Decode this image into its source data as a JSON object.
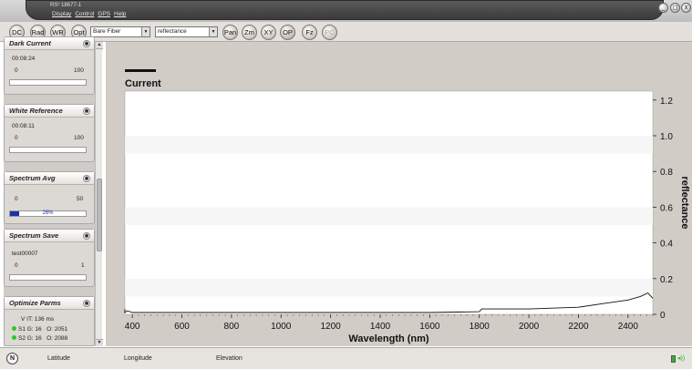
{
  "window": {
    "title": "RS³ 18677-1",
    "menu": [
      "Display",
      "Control",
      "GPS",
      "Help"
    ],
    "controls": [
      "_",
      "◻",
      "x"
    ]
  },
  "toolbar": {
    "buttons": [
      {
        "label": "DC",
        "state": "normal"
      },
      {
        "label": "Rad",
        "state": "normal"
      },
      {
        "label": "WR",
        "state": "normal"
      },
      {
        "label": "Opt",
        "state": "normal"
      },
      {
        "label": "Pan",
        "state": "normal"
      },
      {
        "label": "Zm",
        "state": "normal"
      },
      {
        "label": "XY",
        "state": "normal"
      },
      {
        "label": "OP",
        "state": "active"
      },
      {
        "label": "Fz",
        "state": "normal"
      },
      {
        "label": "PC",
        "state": "disabled"
      }
    ],
    "foreoptic_select": "Bare Fiber",
    "mode_select": "reflectance"
  },
  "sidebar": {
    "dark_current": {
      "title": "Dark Current",
      "time": "00:08:24",
      "min": "0",
      "max": "100",
      "progress": 0
    },
    "white_reference": {
      "title": "White Reference",
      "time": "00:08:11",
      "min": "0",
      "max": "100",
      "progress": 0
    },
    "spectrum_avg": {
      "title": "Spectrum Avg",
      "min": "0",
      "max": "50",
      "progress_text": "26%",
      "progress": 0.26
    },
    "spectrum_save": {
      "title": "Spectrum Save",
      "filename": "test00007",
      "min": "0",
      "max": "1",
      "progress": 0
    },
    "optimize_parms": {
      "title": "Optimize Parms",
      "vit": "V IT: 136 ms",
      "s1": "S1 G: 16   O: 2051",
      "s2": "S2 G: 16   O: 2088"
    }
  },
  "status": {
    "latitude_label": "Latitude",
    "longitude_label": "Longitude",
    "elevation_label": "Elevation"
  },
  "chart_data": {
    "type": "line",
    "legend": [
      "Current"
    ],
    "xlabel": "Wavelength (nm)",
    "ylabel": "reflectance",
    "xlim": [
      370,
      2500
    ],
    "ylim": [
      0,
      1.25
    ],
    "xticks": [
      400,
      600,
      800,
      1000,
      1200,
      1400,
      1600,
      1800,
      2000,
      2200,
      2400
    ],
    "yticks": [
      "0",
      "0.2",
      "0.4",
      "0.6",
      "0.8",
      "1.0",
      "1.2"
    ],
    "grid": "horizontal bands",
    "series": [
      {
        "name": "Current",
        "x": [
          350,
          360,
          370,
          380,
          400,
          500,
          600,
          800,
          1000,
          1200,
          1400,
          1600,
          1800,
          1810,
          2000,
          2200,
          2300,
          2400,
          2450,
          2480,
          2500
        ],
        "y": [
          0.02,
          0.03,
          0.01,
          0.02,
          0.01,
          0.01,
          0.01,
          0.01,
          0.01,
          0.01,
          0.01,
          0.01,
          0.015,
          0.03,
          0.03,
          0.04,
          0.06,
          0.08,
          0.1,
          0.12,
          0.09
        ]
      }
    ]
  }
}
